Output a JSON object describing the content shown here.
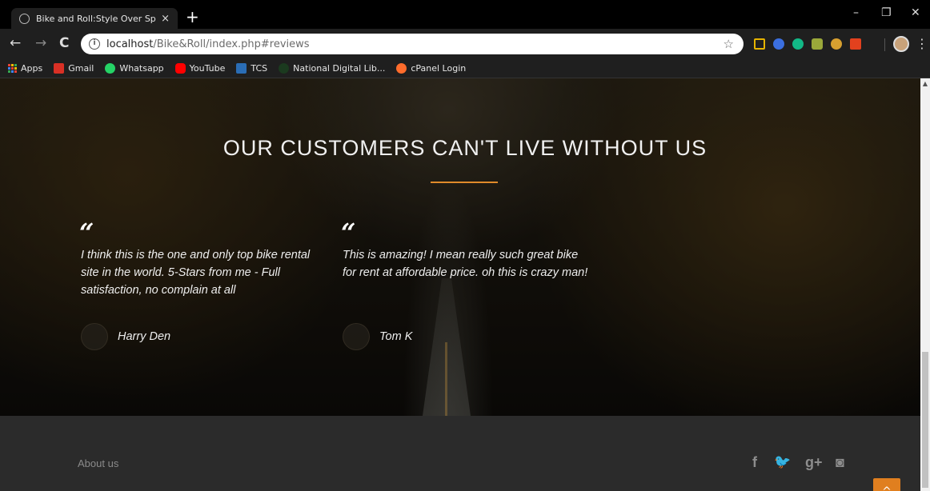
{
  "browser": {
    "tab_title": "Bike and Roll:Style Over Speed!!!",
    "tab_close": "×",
    "new_tab": "+",
    "url_host": "localhost",
    "url_path": "/Bike&Roll/index.php#reviews",
    "window_controls": [
      "–",
      "❐",
      "✕"
    ]
  },
  "bookmarks": [
    {
      "label": "Apps",
      "icon": "apps-grid-icon"
    },
    {
      "label": "Gmail",
      "icon": "gmail-icon",
      "color": "#d93025"
    },
    {
      "label": "Whatsapp",
      "icon": "whatsapp-icon",
      "color": "#25d366"
    },
    {
      "label": "YouTube",
      "icon": "youtube-icon",
      "color": "#ff0000"
    },
    {
      "label": "TCS",
      "icon": "tcs-icon",
      "color": "#2a6db5"
    },
    {
      "label": "National Digital Lib...",
      "icon": "ndl-icon",
      "color": "#1b5e20"
    },
    {
      "label": "cPanel Login",
      "icon": "cpanel-icon",
      "color": "#ff6c2c"
    }
  ],
  "reviews_section": {
    "title": "OUR CUSTOMERS CAN'T LIVE WITHOUT US",
    "accent_color": "#e08a2a",
    "reviews": [
      {
        "quote_mark": "“",
        "text": "I think this is the one and only top bike rental site in the world. 5-Stars from me - Full satisfaction, no complain at all",
        "author": "Harry Den"
      },
      {
        "quote_mark": "“",
        "text": "This is amazing! I mean really such great bike for rent at affordable price. oh this is crazy man!",
        "author": "Tom K"
      }
    ]
  },
  "footer": {
    "about_link": "About us",
    "social": [
      {
        "label": "f",
        "icon": "facebook-icon"
      },
      {
        "label": "🐦",
        "icon": "twitter-icon"
      },
      {
        "label": "g+",
        "icon": "google-plus-icon"
      },
      {
        "label": "◙",
        "icon": "instagram-icon"
      }
    ],
    "back_to_top": "^"
  }
}
